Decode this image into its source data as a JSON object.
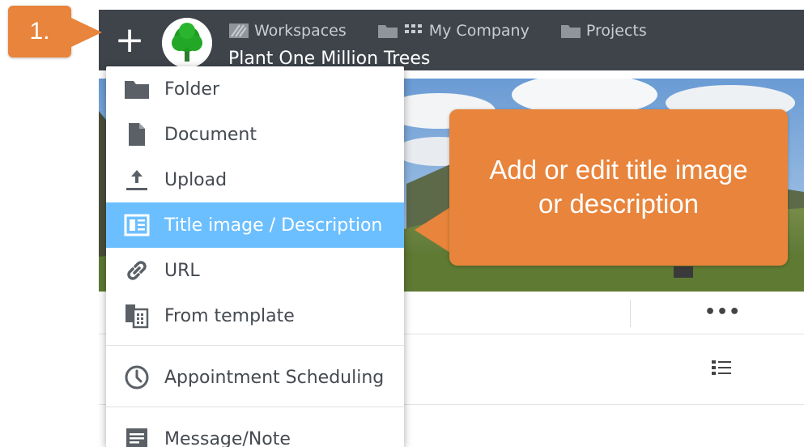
{
  "app": {
    "breadcrumbs": [
      {
        "label": "Workspaces",
        "icon": "workspaces-icon"
      },
      {
        "label": "My Company",
        "icon": "folder-grid-icon"
      },
      {
        "label": "Projects",
        "icon": "folder-icon"
      }
    ],
    "project_title": "Plant One Million Trees",
    "more_label": "•••"
  },
  "menu": {
    "items": [
      {
        "label": "Folder",
        "icon": "folder-icon"
      },
      {
        "label": "Document",
        "icon": "document-icon"
      },
      {
        "label": "Upload",
        "icon": "upload-icon"
      },
      {
        "label": "Title image / Description",
        "icon": "title-image-icon",
        "active": true
      },
      {
        "label": "URL",
        "icon": "link-icon"
      },
      {
        "label": "From template",
        "icon": "template-icon"
      },
      {
        "label": "Appointment Scheduling",
        "icon": "clock-icon"
      },
      {
        "label": "Message/Note",
        "icon": "note-icon"
      }
    ]
  },
  "annotations": {
    "step_label": "1.",
    "callout_line1": "Add or edit title image",
    "callout_line2": "or description"
  },
  "colors": {
    "topbar": "#3e444a",
    "menu_active": "#6cbfff",
    "annotation_orange": "#e8843b"
  }
}
